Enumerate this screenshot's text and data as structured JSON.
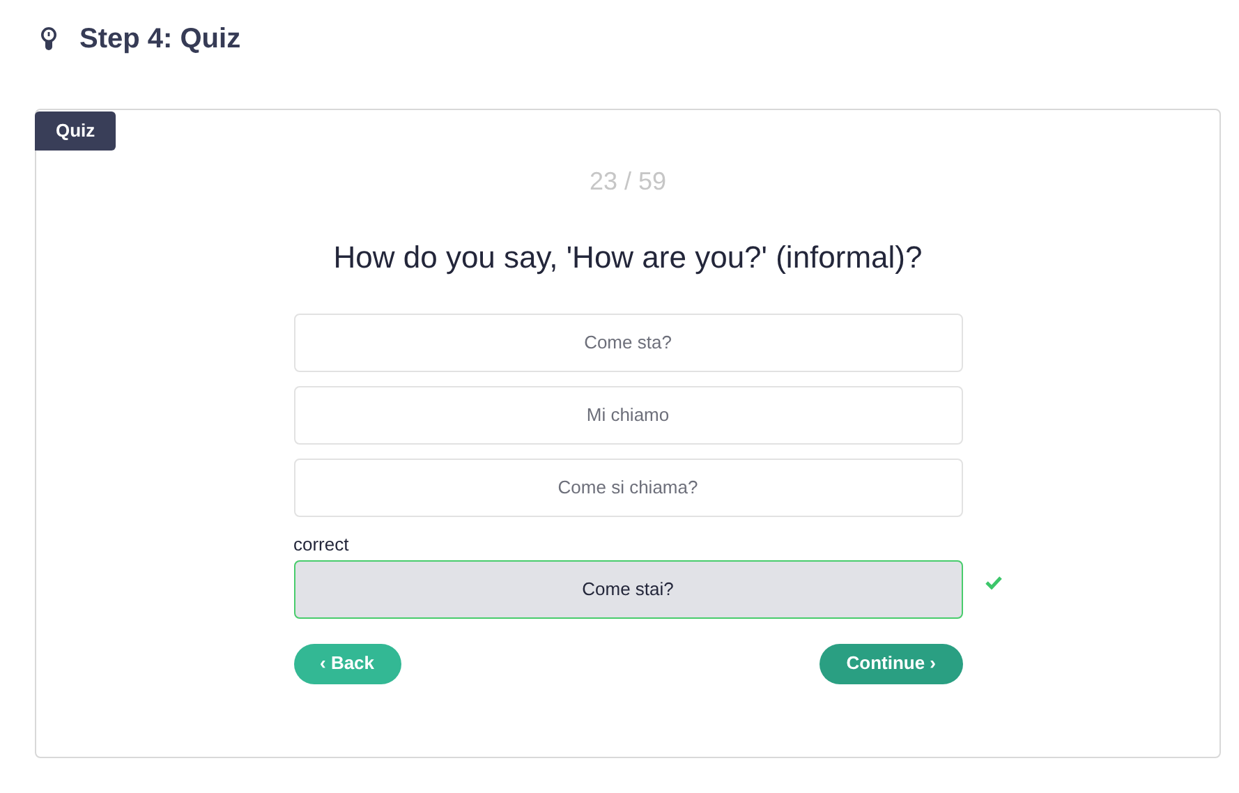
{
  "header": {
    "title": "Step 4: Quiz"
  },
  "quiz": {
    "tab": "Quiz",
    "counter": "23 / 59",
    "question": "How do you say, 'How are you?' (informal)?",
    "options": [
      {
        "text": "Come sta?",
        "selected": false
      },
      {
        "text": "Mi chiamo",
        "selected": false
      },
      {
        "text": "Come si chiama?",
        "selected": false
      },
      {
        "text": "Come stai?",
        "selected": true,
        "note": "correct",
        "correct": true
      }
    ],
    "buttons": [
      {
        "label": "‹ Back",
        "kind": "back"
      },
      {
        "label": "Continue ›",
        "kind": "continue"
      }
    ]
  }
}
